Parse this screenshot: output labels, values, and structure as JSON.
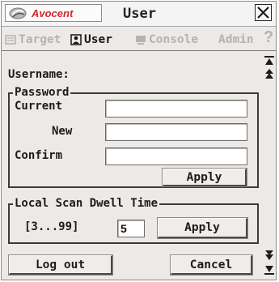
{
  "window": {
    "brand": "Avocent",
    "title": "User",
    "close_icon": "close-x-icon"
  },
  "tabs": [
    {
      "label": "Target",
      "icon": "target-icon",
      "active": false
    },
    {
      "label": "User",
      "icon": "user-icon",
      "active": true
    },
    {
      "label": "Console",
      "icon": "console-icon",
      "active": false
    },
    {
      "label": "Admin",
      "icon": "",
      "active": false
    }
  ],
  "help_label": "?",
  "user_form": {
    "username_label": "Username:",
    "username_value": "",
    "password_group_label": "Password",
    "current_label": "Current",
    "current_value": "",
    "new_label": "New",
    "new_value": "",
    "confirm_label": "Confirm",
    "confirm_value": "",
    "apply_label": "Apply"
  },
  "dwell": {
    "group_label": "Local Scan Dwell Time",
    "range_label": "[3...99]",
    "value": "5",
    "apply_label": "Apply"
  },
  "footer": {
    "logout_label": "Log out",
    "cancel_label": "Cancel"
  },
  "colors": {
    "brand_red": "#d2262c",
    "panel_bg": "#ece9e6"
  }
}
